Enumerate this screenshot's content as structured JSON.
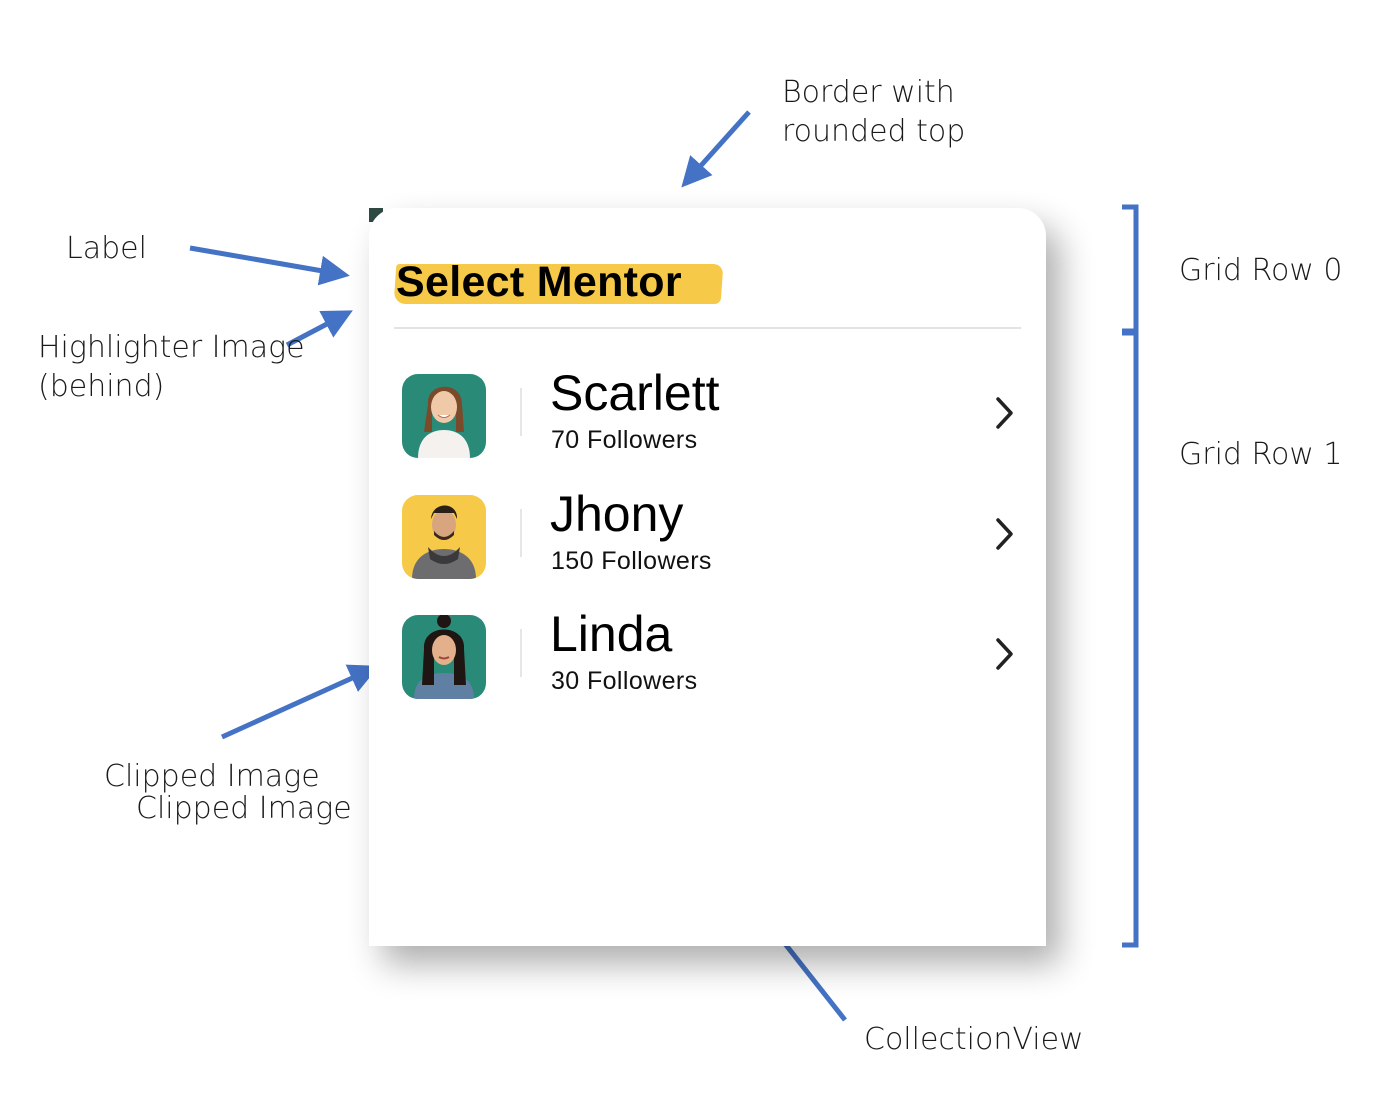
{
  "annotations": {
    "border": [
      "Border with",
      "rounded top"
    ],
    "label": "Label",
    "highlighter": [
      "Highlighter Image",
      "(behind)"
    ],
    "clipped": [
      "Clipped Image",
      "Clipped Image"
    ],
    "collection_view": "CollectionView",
    "grid_row_0": "Grid Row 0",
    "grid_row_1": "Grid Row 1"
  },
  "card": {
    "title": "Select Mentor",
    "mentors": [
      {
        "name": "Scarlett",
        "followers": "70 Followers",
        "avatar_bg": "#2a8a78"
      },
      {
        "name": "Jhony",
        "followers": "150 Followers",
        "avatar_bg": "#f7c948"
      },
      {
        "name": "Linda",
        "followers": "30 Followers",
        "avatar_bg": "#2a8a78"
      }
    ]
  },
  "colors": {
    "arrow": "#4472c4",
    "highlighter": "#f7c948",
    "card_bg": "#ffffff",
    "accent_teal": "#2a8a78"
  }
}
